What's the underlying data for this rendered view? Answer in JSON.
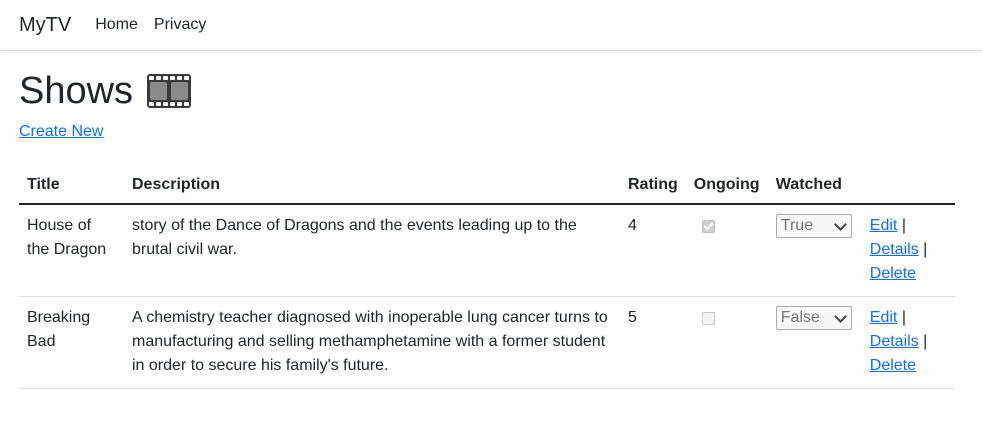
{
  "navbar": {
    "brand": "MyTV",
    "links": [
      "Home",
      "Privacy"
    ]
  },
  "page": {
    "title": "Shows",
    "title_icon": "film-frames-icon",
    "create_link": "Create New"
  },
  "table": {
    "headers": [
      "Title",
      "Description",
      "Rating",
      "Ongoing",
      "Watched",
      ""
    ],
    "rows": [
      {
        "title": "House of the Dragon",
        "description": "story of the Dance of Dragons and the events leading up to the brutal civil war.",
        "rating": "4",
        "ongoing": true,
        "watched": "True"
      },
      {
        "title": "Breaking Bad",
        "description": "A chemistry teacher diagnosed with inoperable lung cancer turns to manufacturing and selling methamphetamine with a former student in order to secure his family's future.",
        "rating": "5",
        "ongoing": false,
        "watched": "False"
      }
    ],
    "actions": {
      "edit": "Edit",
      "details": "Details",
      "delete": "Delete",
      "separator": "|"
    }
  },
  "colors": {
    "link": "#0d6efd",
    "text": "#212529",
    "border": "#dee2e6"
  }
}
